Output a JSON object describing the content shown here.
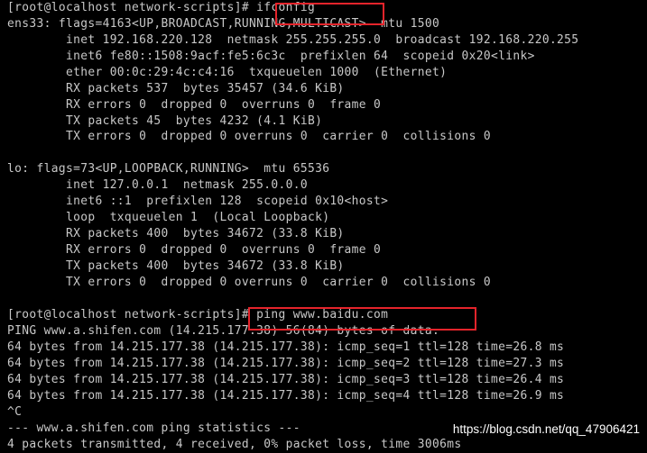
{
  "terminal": {
    "lines": [
      "[root@localhost network-scripts]# ifconfig",
      "ens33: flags=4163<UP,BROADCAST,RUNNING,MULTICAST>  mtu 1500",
      "        inet 192.168.220.128  netmask 255.255.255.0  broadcast 192.168.220.255",
      "        inet6 fe80::1508:9acf:fe5:6c3c  prefixlen 64  scopeid 0x20<link>",
      "        ether 00:0c:29:4c:c4:16  txqueuelen 1000  (Ethernet)",
      "        RX packets 537  bytes 35457 (34.6 KiB)",
      "        RX errors 0  dropped 0  overruns 0  frame 0",
      "        TX packets 45  bytes 4232 (4.1 KiB)",
      "        TX errors 0  dropped 0 overruns 0  carrier 0  collisions 0",
      "",
      "lo: flags=73<UP,LOOPBACK,RUNNING>  mtu 65536",
      "        inet 127.0.0.1  netmask 255.0.0.0",
      "        inet6 ::1  prefixlen 128  scopeid 0x10<host>",
      "        loop  txqueuelen 1  (Local Loopback)",
      "        RX packets 400  bytes 34672 (33.8 KiB)",
      "        RX errors 0  dropped 0  overruns 0  frame 0",
      "        TX packets 400  bytes 34672 (33.8 KiB)",
      "        TX errors 0  dropped 0 overruns 0  carrier 0  collisions 0",
      "",
      "[root@localhost network-scripts]# ping www.baidu.com",
      "PING www.a.shifen.com (14.215.177.38) 56(84) bytes of data.",
      "64 bytes from 14.215.177.38 (14.215.177.38): icmp_seq=1 ttl=128 time=26.8 ms",
      "64 bytes from 14.215.177.38 (14.215.177.38): icmp_seq=2 ttl=128 time=27.3 ms",
      "64 bytes from 14.215.177.38 (14.215.177.38): icmp_seq=3 ttl=128 time=26.4 ms",
      "64 bytes from 14.215.177.38 (14.215.177.38): icmp_seq=4 ttl=128 time=26.9 ms",
      "^C",
      "--- www.a.shifen.com ping statistics ---",
      "4 packets transmitted, 4 received, 0% packet loss, time 3006ms"
    ]
  },
  "watermark": "https://blog.csdn.net/qq_47906421",
  "colors": {
    "background": "#000000",
    "text": "#c8c8c8",
    "highlight_box": "#e5242b",
    "watermark": "#ffffff"
  }
}
